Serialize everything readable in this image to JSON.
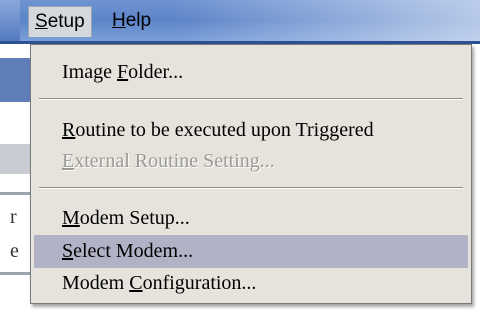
{
  "menubar": {
    "menus": [
      {
        "label": "Setup",
        "mnemonic": "S",
        "rest": "etup",
        "active": true
      },
      {
        "label": "Help",
        "mnemonic": "H",
        "rest": "elp",
        "active": false
      }
    ]
  },
  "background": {
    "fragments": [
      "r",
      "e"
    ]
  },
  "dropdown": {
    "items": [
      {
        "pre": "Image ",
        "mnemonic": "F",
        "post": "older...",
        "enabled": true
      },
      {
        "pre": "",
        "mnemonic": "R",
        "post": "outine to be executed upon Triggered",
        "enabled": true
      },
      {
        "pre": "",
        "mnemonic": "E",
        "post": "xternal Routine Setting...",
        "enabled": false
      },
      {
        "pre": "",
        "mnemonic": "M",
        "post": "odem Setup...",
        "enabled": true
      },
      {
        "pre": "",
        "mnemonic": "S",
        "post": "elect Modem...",
        "enabled": true,
        "highlighted": true
      },
      {
        "pre": "Modem ",
        "mnemonic": "C",
        "post": "onfiguration...",
        "enabled": true
      }
    ]
  },
  "colors": {
    "menubar": "#5c84c8",
    "menu_bg": "#e6e3dc",
    "highlight": "#b2b2c6",
    "disabled_text": "#9c9a94"
  }
}
